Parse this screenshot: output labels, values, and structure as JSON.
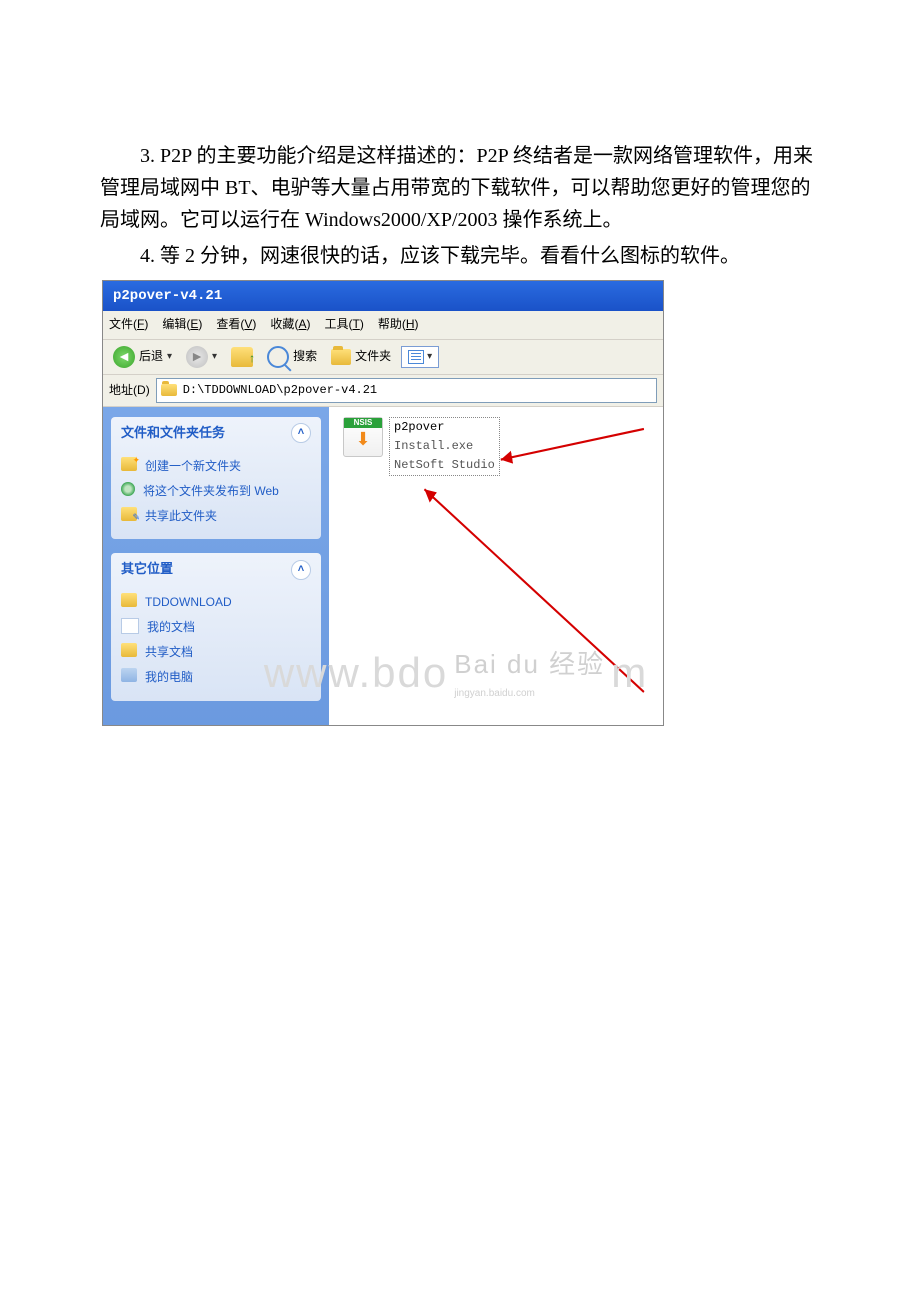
{
  "doc": {
    "para3": "3. P2P 的主要功能介绍是这样描述的：P2P 终结者是一款网络管理软件，用来管理局域网中 BT、电驴等大量占用带宽的下载软件，可以帮助您更好的管理您的局域网。它可以运行在 Windows2000/XP/2003 操作系统上。",
    "para4": "4. 等 2 分钟，网速很快的话，应该下载完毕。看看什么图标的软件。"
  },
  "window": {
    "title": "p2pover-v4.21",
    "menus": {
      "file": {
        "label": "文件",
        "hot": "F"
      },
      "edit": {
        "label": "编辑",
        "hot": "E"
      },
      "view": {
        "label": "查看",
        "hot": "V"
      },
      "fav": {
        "label": "收藏",
        "hot": "A"
      },
      "tools": {
        "label": "工具",
        "hot": "T"
      },
      "help": {
        "label": "帮助",
        "hot": "H"
      }
    },
    "toolbar": {
      "back": "后退",
      "search": "搜索",
      "folders": "文件夹"
    },
    "address": {
      "label": "地址",
      "hot": "D",
      "path": "D:\\TDDOWNLOAD\\p2pover-v4.21"
    },
    "sidepanel": {
      "tasks_title": "文件和文件夹任务",
      "tasks": {
        "new_folder": "创建一个新文件夹",
        "publish": "将这个文件夹发布到 Web",
        "share": "共享此文件夹"
      },
      "other_title": "其它位置",
      "other": {
        "tddownload": "TDDOWNLOAD",
        "mydocs": "我的文档",
        "shareddocs": "共享文档",
        "mycomputer": "我的电脑"
      }
    },
    "file_tile": {
      "nsis": "NSIS",
      "name": "p2pover",
      "ext": "Install.exe",
      "vendor": "NetSoft Studio"
    },
    "watermark": {
      "left": "www.bdo",
      "brand": "Bai du 经验",
      "sub": "jingyan.baidu.com",
      "right": "m"
    }
  }
}
